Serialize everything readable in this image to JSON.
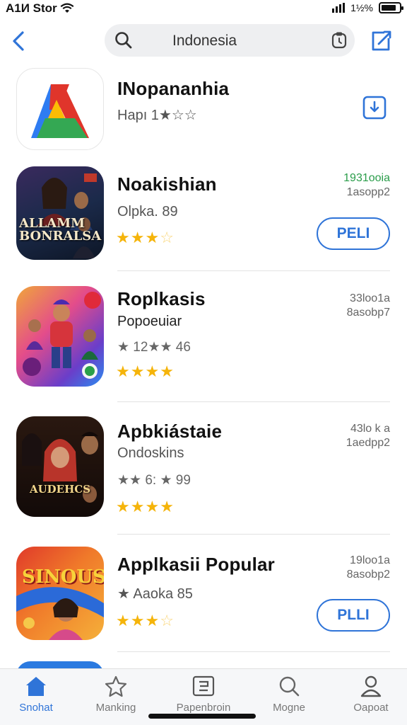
{
  "status": {
    "carrier": "A1И Stor",
    "battery_text": "1½%",
    "battery_level": 0.85
  },
  "nav": {
    "search_text": "Indonesia"
  },
  "apps": [
    {
      "title": "INopananhia",
      "sub": "Hapı 1★☆☆",
      "sub2": "",
      "rating": 0,
      "meta1": "",
      "meta2": "",
      "button": ""
    },
    {
      "title": "Noakishian",
      "sub": "Olpka. 89",
      "sub2": "",
      "rating": 3,
      "meta1": "1931ooia",
      "meta2": "1asopp2",
      "button": "PELI",
      "icon_caption": "ALLAMM BONRALSA"
    },
    {
      "title": "Roplkasis",
      "sub": "Popoeuiar",
      "sub2": "★ 12★★ 46",
      "rating": 4,
      "meta1": "33loo1a",
      "meta2": "8asobp7",
      "button": ""
    },
    {
      "title": "Apbkiástaie",
      "sub": "Ondoskins",
      "sub2": "★★ 6: ★ 99",
      "rating": 4,
      "meta1": "43lo k a",
      "meta2": "1aedpp2",
      "button": "",
      "icon_caption": "AUDEHCS"
    },
    {
      "title": "Applkasii Popular",
      "sub": "★ Aaoka 85",
      "sub2": "",
      "rating": 3,
      "meta1": "19loo1a",
      "meta2": "8asobp2",
      "button": "PLLI",
      "icon_caption": "SINOUS"
    }
  ],
  "tabs": [
    {
      "label": "Snohat",
      "icon": "home-icon",
      "active": true
    },
    {
      "label": "Manking",
      "icon": "star-icon",
      "active": false
    },
    {
      "label": "Papenbroin",
      "icon": "apps-icon",
      "active": false
    },
    {
      "label": "Mogne",
      "icon": "search-icon",
      "active": false
    },
    {
      "label": "Oapoat",
      "icon": "person-icon",
      "active": false
    }
  ],
  "colors": {
    "accent": "#2f74d8",
    "star": "#f5b40a",
    "green": "#2a9d4a"
  }
}
